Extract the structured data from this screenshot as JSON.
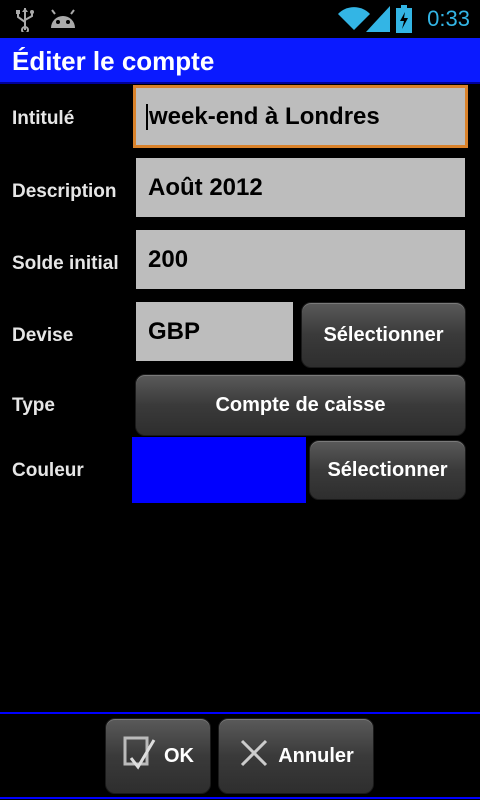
{
  "status_bar": {
    "time": "0:33",
    "left_icons": [
      "usb-icon",
      "android-icon"
    ],
    "right_icons": [
      "wifi-icon",
      "signal-icon",
      "battery-charging-icon"
    ]
  },
  "title": "Éditer le compte",
  "form": {
    "intitule": {
      "label": "Intitulé",
      "value": "week-end à Londres"
    },
    "description": {
      "label": "Description",
      "value": "Août 2012"
    },
    "solde": {
      "label": "Solde initial",
      "value": "200"
    },
    "devise": {
      "label": "Devise",
      "value": "GBP",
      "button": "Sélectionner"
    },
    "type": {
      "label": "Type",
      "value": "Compte de caisse"
    },
    "couleur": {
      "label": "Couleur",
      "color": "#0000ff",
      "button": "Sélectionner"
    }
  },
  "actions": {
    "ok": "OK",
    "cancel": "Annuler"
  },
  "colors": {
    "accent": "#0a1aff",
    "status_time": "#33b5e5",
    "focus_border": "#d9822b",
    "field_bg": "#bdbdbd"
  }
}
